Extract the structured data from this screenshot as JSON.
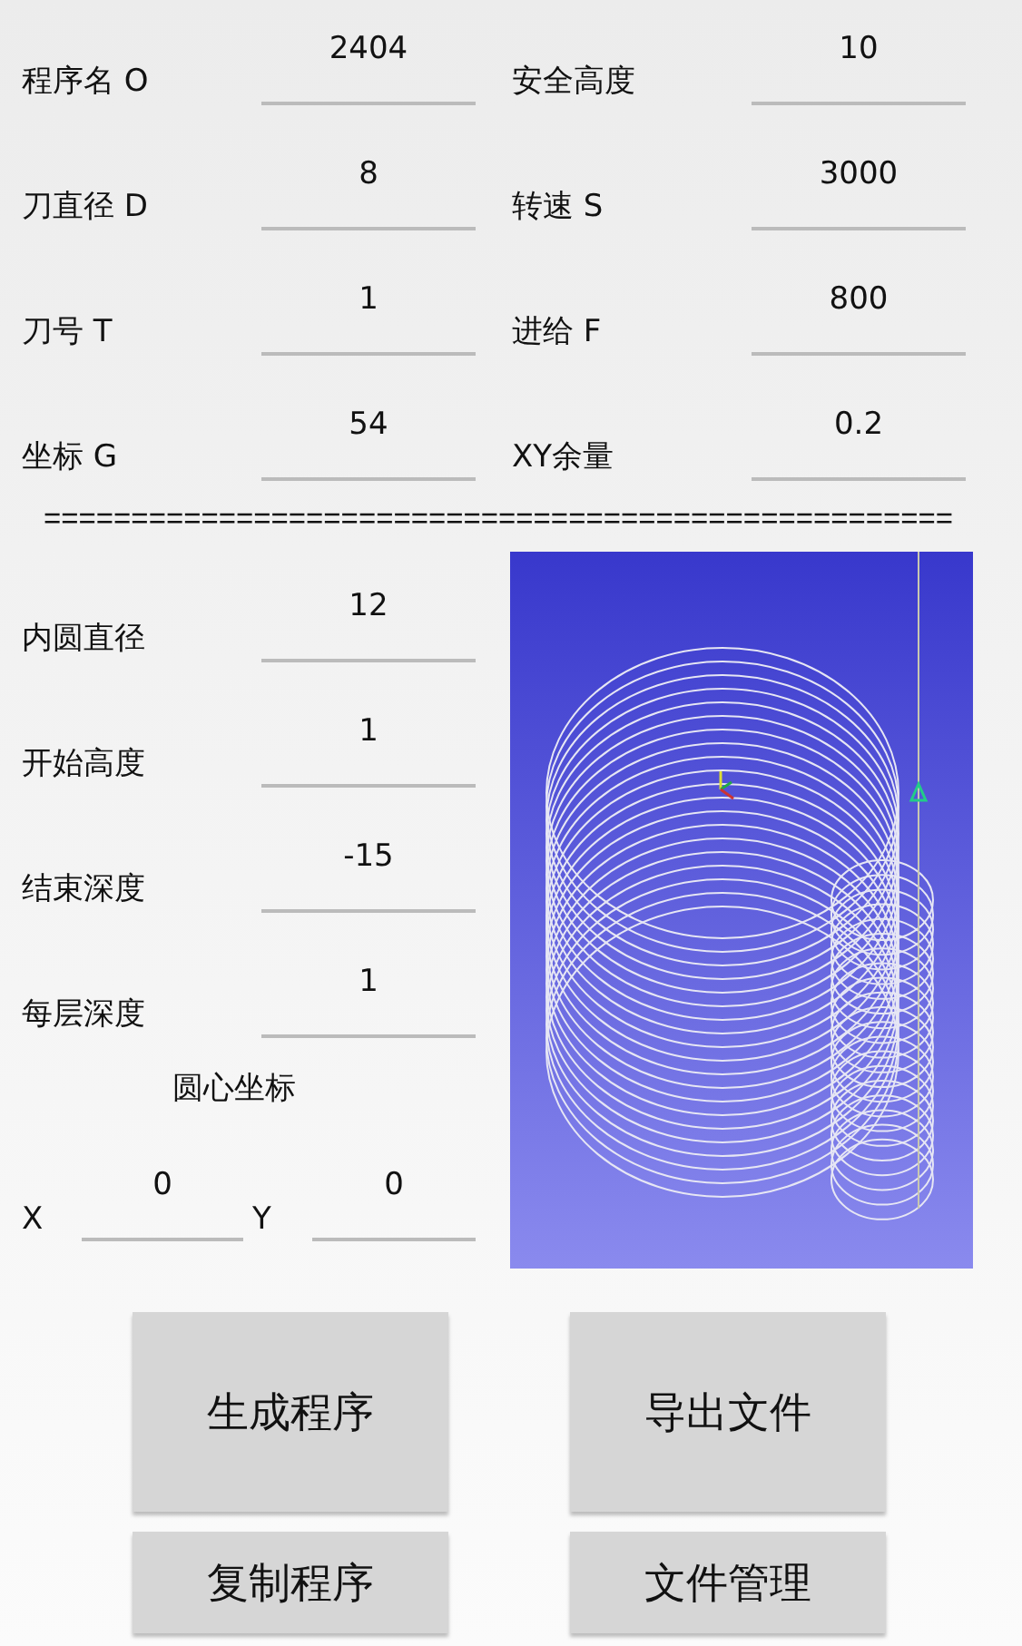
{
  "parameters": [
    {
      "label": "程序名 O",
      "value": "2404"
    },
    {
      "label": "安全高度",
      "value": "10"
    },
    {
      "label": "刀直径 D",
      "value": "8"
    },
    {
      "label": "转速 S",
      "value": "3000"
    },
    {
      "label": "刀号 T",
      "value": "1"
    },
    {
      "label": "进给 F",
      "value": "800"
    },
    {
      "label": "坐标 G",
      "value": "54"
    },
    {
      "label": "XY余量",
      "value": "0.2"
    }
  ],
  "separator": "====================================================",
  "circle_parameters": [
    {
      "label": "内圆直径",
      "value": "12"
    },
    {
      "label": "开始高度",
      "value": "1"
    },
    {
      "label": "结束深度",
      "value": "-15"
    },
    {
      "label": "每层深度",
      "value": "1"
    }
  ],
  "center_label": "圆心坐标",
  "center": [
    {
      "label": "X",
      "value": "0"
    },
    {
      "label": "Y",
      "value": "0"
    }
  ],
  "buttons": [
    "生成程序",
    "导出文件",
    "复制程序",
    "文件管理"
  ]
}
